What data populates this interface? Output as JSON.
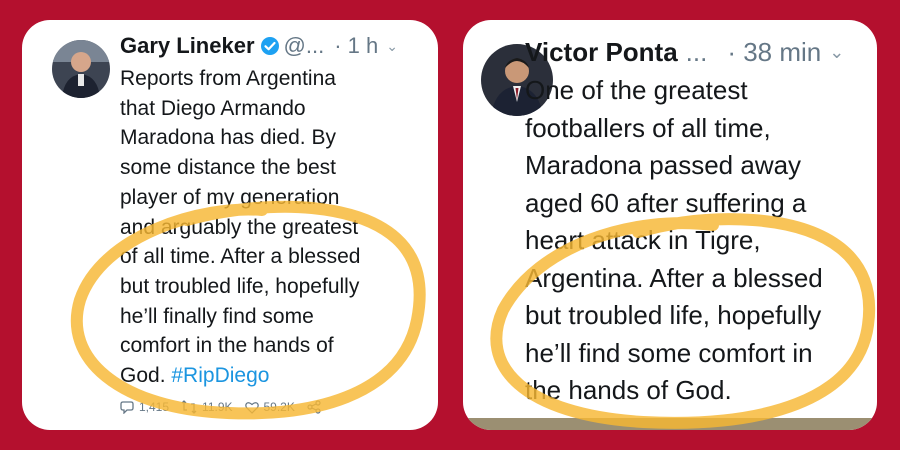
{
  "tweets": [
    {
      "name": "Gary Lineker",
      "handle": "@...",
      "time": "· 1 h",
      "avatar_icon": "person-avatar-icon",
      "verified_icon": "verified-badge-icon",
      "verified_color": "#1da1f2",
      "lines": [
        "Reports from Argentina",
        "that Diego Armando",
        "Maradona has died. By",
        "some distance the best",
        "player of my generation",
        "and arguably the greatest",
        "of all time. After a blessed",
        "but troubled life, hopefully",
        "he’ll finally find some",
        "comfort in the hands of"
      ],
      "last_line_text": "God.",
      "hashtag": "#RipDiego",
      "actions": {
        "replies": "1,415",
        "retweets": "11.9K",
        "likes": "59.2K"
      }
    },
    {
      "name": "Victor Ponta",
      "handle": "...",
      "time": "· 38 min",
      "avatar_icon": "person-avatar-icon",
      "lines": [
        "One of the greatest",
        "footballers of all time,",
        "Maradona passed away",
        "aged 60 after suffering a",
        "heart attack in Tigre,",
        "Argentina. After a blessed",
        "but troubled life, hopefully",
        "he’ll find some comfort in",
        "the hands of God."
      ]
    }
  ],
  "colors": {
    "background": "#b4102e",
    "highlight": "#f7b733",
    "hashtag": "#1b95e0"
  }
}
